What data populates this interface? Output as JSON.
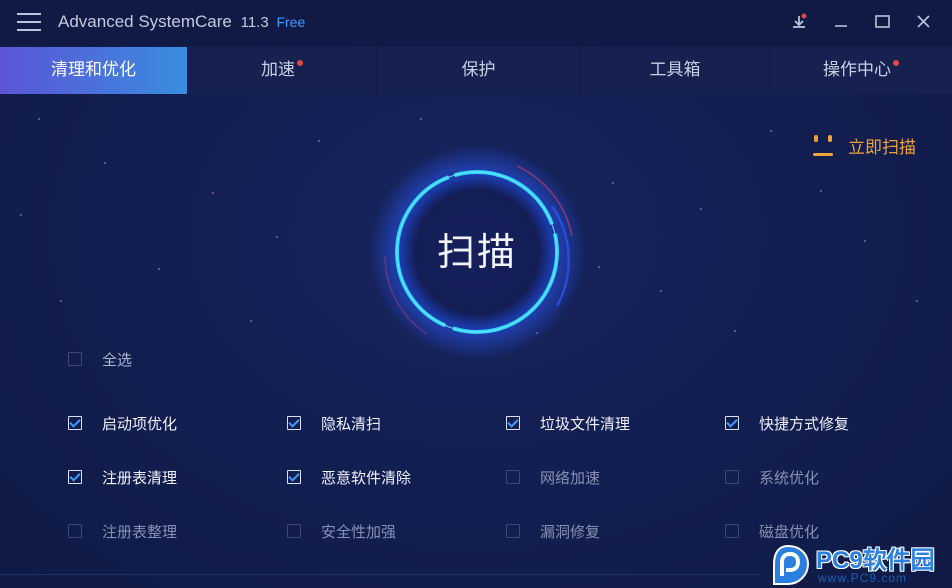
{
  "window": {
    "app_name": "Advanced SystemCare",
    "version": "11.3",
    "edition": "Free"
  },
  "tabs": [
    {
      "label": "清理和优化",
      "active": true,
      "badge": false
    },
    {
      "label": "加速",
      "active": false,
      "badge": true
    },
    {
      "label": "保护",
      "active": false,
      "badge": false
    },
    {
      "label": "工具箱",
      "active": false,
      "badge": false
    },
    {
      "label": "操作中心",
      "active": false,
      "badge": true
    }
  ],
  "scan_now": {
    "label": "立即扫描"
  },
  "scan_button": {
    "label": "扫描"
  },
  "select_all": {
    "label": "全选",
    "checked": false
  },
  "options": [
    {
      "label": "启动项优化",
      "checked": true
    },
    {
      "label": "隐私清扫",
      "checked": true
    },
    {
      "label": "垃圾文件清理",
      "checked": true
    },
    {
      "label": "快捷方式修复",
      "checked": true
    },
    {
      "label": "注册表清理",
      "checked": true
    },
    {
      "label": "恶意软件清除",
      "checked": true
    },
    {
      "label": "网络加速",
      "checked": false
    },
    {
      "label": "系统优化",
      "checked": false
    },
    {
      "label": "注册表整理",
      "checked": false
    },
    {
      "label": "安全性加强",
      "checked": false
    },
    {
      "label": "漏洞修复",
      "checked": false
    },
    {
      "label": "磁盘优化",
      "checked": false
    }
  ],
  "watermark": {
    "name": "PC9软件园",
    "url": "www.PC9.com"
  },
  "colors": {
    "background": "#131f52",
    "accent_blue": "#3e9bff",
    "active_tab_start": "#5b55d6",
    "active_tab_end": "#3a8de0",
    "scan_now_orange": "#f0a33a",
    "badge_red": "#e2463f"
  },
  "icons": {
    "menu": "hamburger-menu-icon",
    "download": "download-update-icon",
    "minimize": "minimize-icon",
    "maximize": "maximize-icon",
    "close": "close-icon",
    "scan_now": "smiley-face-icon"
  }
}
